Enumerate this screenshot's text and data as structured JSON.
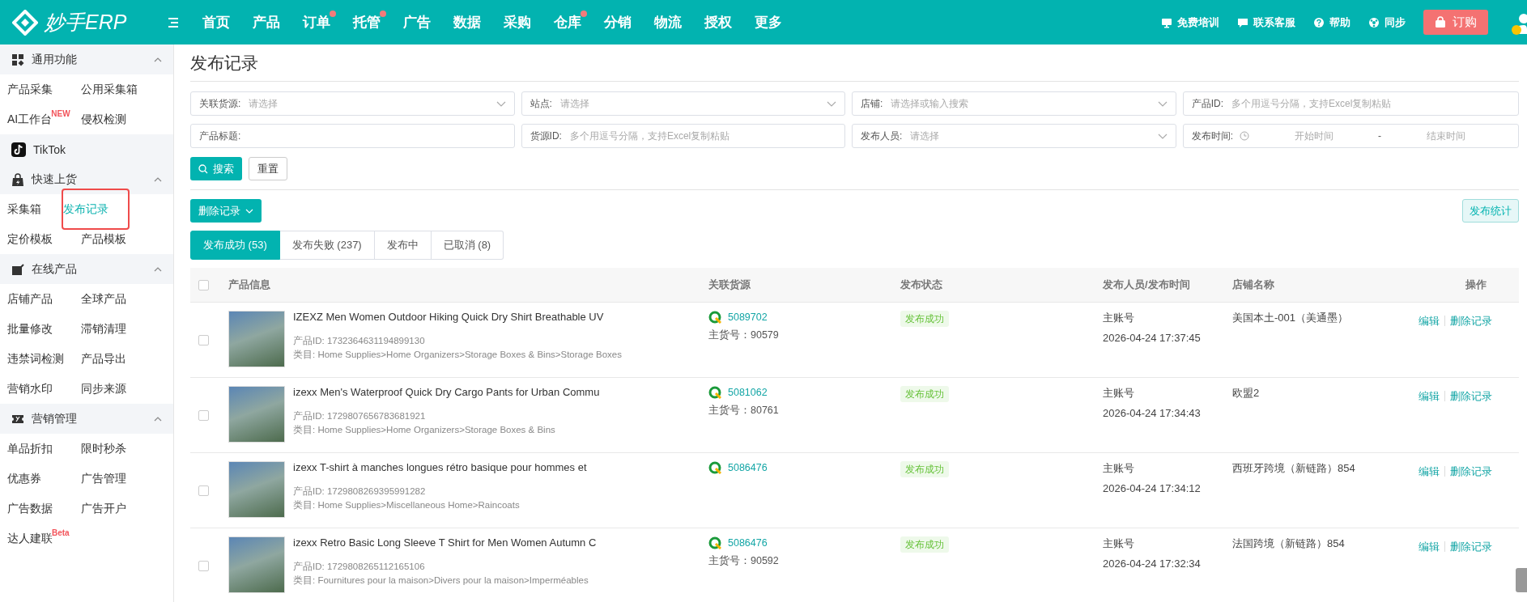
{
  "brand": {
    "name": "妙手ERP"
  },
  "nav": [
    {
      "label": "首页",
      "dot": false
    },
    {
      "label": "产品",
      "dot": false
    },
    {
      "label": "订单",
      "dot": true
    },
    {
      "label": "托管",
      "dot": true
    },
    {
      "label": "广告",
      "dot": false
    },
    {
      "label": "数据",
      "dot": false
    },
    {
      "label": "采购",
      "dot": false
    },
    {
      "label": "仓库",
      "dot": true
    },
    {
      "label": "分销",
      "dot": false
    },
    {
      "label": "物流",
      "dot": false
    },
    {
      "label": "授权",
      "dot": false
    },
    {
      "label": "更多",
      "dot": false
    }
  ],
  "top_actions": [
    {
      "kind": "training",
      "label": "免费培训"
    },
    {
      "kind": "service",
      "label": "联系客服"
    },
    {
      "kind": "help",
      "label": "帮助"
    },
    {
      "kind": "sync",
      "label": "同步"
    }
  ],
  "order_button": "订购",
  "sidebar": {
    "sections": [
      {
        "kind": "group",
        "title": "通用功能",
        "expanded": true,
        "items": [
          {
            "label": "产品采集",
            "selected": false
          },
          {
            "label": "公用采集箱",
            "selected": false
          },
          {
            "label": "AI工作台",
            "badge": "NEW",
            "selected": false
          },
          {
            "label": "侵权检测",
            "selected": false
          }
        ]
      },
      {
        "kind": "link",
        "title": "TikTok"
      },
      {
        "kind": "group",
        "title": "快速上货",
        "expanded": true,
        "items": [
          {
            "label": "采集箱",
            "selected": false
          },
          {
            "label": "发布记录",
            "selected": true
          },
          {
            "label": "定价模板",
            "selected": false
          },
          {
            "label": "产品模板",
            "selected": false
          }
        ]
      },
      {
        "kind": "group",
        "title": "在线产品",
        "expanded": true,
        "items": [
          {
            "label": "店铺产品",
            "selected": false
          },
          {
            "label": "全球产品",
            "selected": false
          },
          {
            "label": "批量修改",
            "selected": false
          },
          {
            "label": "滞销清理",
            "selected": false
          },
          {
            "label": "违禁词检测",
            "selected": false
          },
          {
            "label": "产品导出",
            "selected": false
          },
          {
            "label": "营销水印",
            "selected": false
          },
          {
            "label": "同步来源",
            "selected": false
          }
        ]
      },
      {
        "kind": "group",
        "title": "营销管理",
        "expanded": true,
        "items": [
          {
            "label": "单品折扣",
            "selected": false
          },
          {
            "label": "限时秒杀",
            "selected": false
          },
          {
            "label": "优惠券",
            "selected": false
          },
          {
            "label": "广告管理",
            "selected": false
          },
          {
            "label": "广告数据",
            "selected": false
          },
          {
            "label": "广告开户",
            "selected": false
          },
          {
            "label": "达人建联",
            "badge": "Beta",
            "selected": false
          }
        ]
      }
    ]
  },
  "page_title": "发布记录",
  "filters": [
    {
      "kind": "select",
      "label": "关联货源:",
      "placeholder": "请选择"
    },
    {
      "kind": "select",
      "label": "站点:",
      "placeholder": "请选择"
    },
    {
      "kind": "select",
      "label": "店铺:",
      "placeholder": "请选择或输入搜索"
    },
    {
      "kind": "text",
      "label": "产品ID:",
      "placeholder": "多个用逗号分隔，支持Excel复制粘贴"
    },
    {
      "kind": "text",
      "label": "产品标题:"
    },
    {
      "kind": "text",
      "label": "货源ID:",
      "placeholder": "多个用逗号分隔，支持Excel复制粘贴"
    },
    {
      "kind": "select",
      "label": "发布人员:",
      "placeholder": "请选择"
    },
    {
      "kind": "daterange",
      "label": "发布时间:",
      "start_placeholder": "开始时间",
      "separator": "-",
      "end_placeholder": "结束时间"
    }
  ],
  "buttons": {
    "search": "搜索",
    "reset": "重置",
    "delete": "删除记录",
    "stats": "发布统计"
  },
  "tabs": [
    {
      "label": "发布成功 (53)",
      "selected": true
    },
    {
      "label": "发布失败 (237)",
      "selected": false
    },
    {
      "label": "发布中",
      "selected": false
    },
    {
      "label": "已取消 (8)",
      "selected": false
    }
  ],
  "table": {
    "select_all": false,
    "columns": [
      "产品信息",
      "关联货源",
      "发布状态",
      "发布人员/发布时间",
      "店铺名称",
      "操作"
    ],
    "rows": [
      {
        "checked": false,
        "title": "IZEXZ Men Women Outdoor Hiking Quick Dry Shirt Breathable UV",
        "product_id": "产品ID: 1732364631194899130",
        "category": "类目: Home Supplies>Home Organizers>Storage Boxes & Bins>Storage Boxes",
        "source_id": "5089702",
        "source_sku": "主货号：90579",
        "status": "发布成功",
        "publisher": "主账号",
        "time": "2026-04-24 17:37:45",
        "store": "美国本土-001（美通墨）",
        "actions": [
          "编辑",
          "删除记录"
        ]
      },
      {
        "checked": false,
        "title": "izexx Men's Waterproof Quick Dry Cargo Pants for Urban Commu",
        "product_id": "产品ID: 1729807656783681921",
        "category": "类目: Home Supplies>Home Organizers>Storage Boxes & Bins",
        "source_id": "5081062",
        "source_sku": "主货号：80761",
        "status": "发布成功",
        "publisher": "主账号",
        "time": "2026-04-24 17:34:43",
        "store": "欧盟2",
        "actions": [
          "编辑",
          "删除记录"
        ]
      },
      {
        "checked": false,
        "title": "izexx T-shirt à manches longues rétro basique pour hommes et",
        "product_id": "产品ID: 1729808269395991282",
        "category": "类目: Home Supplies>Miscellaneous Home>Raincoats",
        "source_id": "5086476",
        "status": "发布成功",
        "publisher": "主账号",
        "time": "2026-04-24 17:34:12",
        "store": "西班牙跨境（新链路）854",
        "actions": [
          "编辑",
          "删除记录"
        ]
      },
      {
        "checked": false,
        "title": "izexx Retro Basic Long Sleeve T Shirt for Men Women Autumn C",
        "product_id": "产品ID: 1729808265112165106",
        "category": "类目: Fournitures pour la maison>Divers pour la maison>Imperméables",
        "source_id": "5086476",
        "source_sku": "主货号：90592",
        "status": "发布成功",
        "publisher": "主账号",
        "time": "2026-04-24 17:32:34",
        "store": "法国跨境（新链路）854",
        "actions": [
          "编辑",
          "删除记录"
        ]
      }
    ]
  }
}
